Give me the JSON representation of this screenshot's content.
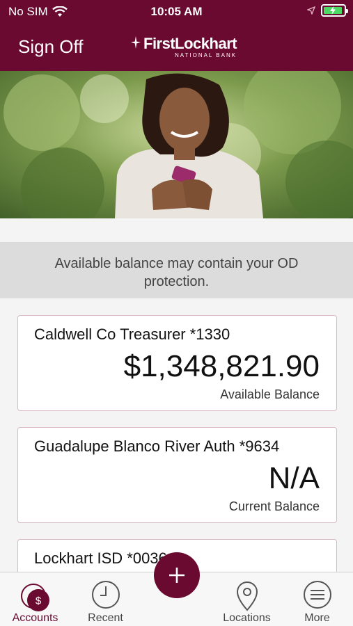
{
  "status_bar": {
    "carrier": "No SIM",
    "time": "10:05 AM"
  },
  "nav": {
    "sign_off_label": "Sign Off",
    "brand_name": "FirstLockhart",
    "brand_sub": "NATIONAL BANK"
  },
  "notice": "Available balance may contain your OD protection.",
  "accounts": [
    {
      "name": "Caldwell Co Treasurer *1330",
      "amount": "$1,348,821.90",
      "balance_label": "Available Balance"
    },
    {
      "name": "Guadalupe Blanco River Auth *9634",
      "amount": "N/A",
      "balance_label": "Current Balance"
    },
    {
      "name": "Lockhart ISD *0036"
    }
  ],
  "tabs": [
    {
      "label": "Accounts",
      "icon": "dollar-icon"
    },
    {
      "label": "Recent",
      "icon": "clock-icon"
    },
    {
      "label": "Locations",
      "icon": "map-pin-icon"
    },
    {
      "label": "More",
      "icon": "menu-icon"
    }
  ],
  "colors": {
    "brand": "#6b0a30",
    "battery": "#4cd964"
  }
}
